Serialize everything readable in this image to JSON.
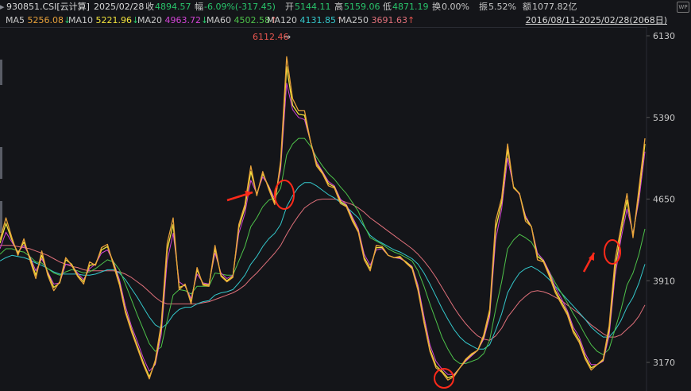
{
  "header": {
    "code": "930851.CSI[云计算]",
    "date": "2025/02/28",
    "close_label": "收",
    "close_value": "4894.57",
    "change_label": "幅",
    "change_value": "-6.09%(-317.45)",
    "open_label": "开",
    "open_value": "5144.11",
    "high_label": "高",
    "high_value": "5159.06",
    "low_label": "低",
    "low_value": "4871.19",
    "turnover_label": "换",
    "turnover_value": "0.00%",
    "amplitude_label": "振",
    "amplitude_value": "5.52%",
    "amount_label": "额",
    "amount_value": "1077.82亿",
    "range_label": "2016/08/11-2025/02/28(2068日)"
  },
  "ma_legend": [
    {
      "label": "MA5",
      "value": "5256.08",
      "arrow": "↓",
      "color": "#e8a13a"
    },
    {
      "label": "MA10",
      "value": "5221.96",
      "arrow": "↓",
      "color": "#f2e33c"
    },
    {
      "label": "MA20",
      "value": "4963.72",
      "arrow": "↓",
      "color": "#d244d6"
    },
    {
      "label": "MA60",
      "value": "4502.58",
      "arrow": "↑",
      "color": "#4ec24a"
    },
    {
      "label": "MA120",
      "value": "4131.85",
      "arrow": "↑",
      "color": "#34c8cc"
    },
    {
      "label": "MA250",
      "value": "3691.63",
      "arrow": "↑",
      "color": "#e0707a"
    }
  ],
  "corner_icon": "wp-icon",
  "chart_data": {
    "type": "line",
    "title": "",
    "yticks": [
      6130,
      5390,
      4650,
      3910,
      3170
    ],
    "ylim": [
      3000,
      6260
    ],
    "peak_label": "6112.46",
    "peak_arrow": "→",
    "grid": false,
    "series": [
      {
        "name": "MA5",
        "color": "#e8a13a",
        "values": [
          4280,
          4480,
          4300,
          4140,
          4290,
          4100,
          3930,
          4180,
          3960,
          3820,
          3900,
          4120,
          4050,
          3950,
          3880,
          4080,
          4050,
          4210,
          4240,
          4050,
          3870,
          3620,
          3450,
          3300,
          3150,
          3020,
          3190,
          3520,
          4250,
          4480,
          3830,
          3880,
          3700,
          4030,
          3870,
          3860,
          4230,
          3950,
          3900,
          3940,
          4420,
          4600,
          4950,
          4680,
          4900,
          4740,
          4600,
          5000,
          5940,
          5560,
          5450,
          5450,
          5170,
          4950,
          4880,
          4770,
          4750,
          4610,
          4580,
          4450,
          4350,
          4100,
          4000,
          4230,
          4220,
          4140,
          4120,
          4130,
          4070,
          4020,
          3820,
          3530,
          3270,
          3120,
          3080,
          3010,
          3040,
          3120,
          3200,
          3250,
          3280,
          3420,
          3650,
          4450,
          4660,
          5150,
          4750,
          4700,
          4450,
          4400,
          4100,
          4080,
          3950,
          3800,
          3700,
          3600,
          3440,
          3350,
          3200,
          3100,
          3150,
          3200,
          3500,
          4100,
          4400,
          4700,
          4300,
          4750,
          5200
        ]
      },
      {
        "name": "MA10",
        "color": "#f2e33c",
        "values": [
          4250,
          4430,
          4280,
          4160,
          4260,
          4120,
          3960,
          4140,
          3980,
          3850,
          3890,
          4100,
          4060,
          3960,
          3900,
          4050,
          4060,
          4190,
          4220,
          4070,
          3890,
          3640,
          3470,
          3320,
          3170,
          3040,
          3170,
          3480,
          4190,
          4420,
          3850,
          3870,
          3720,
          4010,
          3880,
          3870,
          4200,
          3960,
          3910,
          3950,
          4390,
          4570,
          4900,
          4690,
          4880,
          4760,
          4620,
          4970,
          5850,
          5500,
          5420,
          5410,
          5170,
          4970,
          4890,
          4790,
          4760,
          4630,
          4590,
          4470,
          4360,
          4120,
          4020,
          4210,
          4210,
          4140,
          4120,
          4120,
          4080,
          4030,
          3840,
          3550,
          3290,
          3140,
          3090,
          3030,
          3050,
          3120,
          3190,
          3240,
          3280,
          3400,
          3620,
          4380,
          4620,
          5100,
          4760,
          4700,
          4480,
          4400,
          4130,
          4090,
          3970,
          3820,
          3720,
          3620,
          3460,
          3370,
          3220,
          3120,
          3150,
          3190,
          3460,
          4020,
          4350,
          4640,
          4320,
          4700,
          5150
        ]
      },
      {
        "name": "MA20",
        "color": "#d244d6",
        "values": [
          4200,
          4350,
          4260,
          4170,
          4230,
          4130,
          4000,
          4110,
          3990,
          3880,
          3890,
          4060,
          4050,
          3980,
          3920,
          4020,
          4060,
          4160,
          4190,
          4080,
          3920,
          3680,
          3500,
          3360,
          3210,
          3090,
          3150,
          3420,
          4090,
          4340,
          3900,
          3860,
          3750,
          3970,
          3890,
          3880,
          4160,
          3980,
          3930,
          3960,
          4340,
          4520,
          4820,
          4700,
          4850,
          4770,
          4650,
          4920,
          5700,
          5460,
          5390,
          5370,
          5170,
          4990,
          4900,
          4810,
          4770,
          4650,
          4600,
          4490,
          4380,
          4150,
          4050,
          4190,
          4200,
          4140,
          4120,
          4110,
          4080,
          4040,
          3870,
          3590,
          3330,
          3180,
          3110,
          3060,
          3060,
          3120,
          3180,
          3230,
          3280,
          3380,
          3580,
          4280,
          4560,
          5020,
          4760,
          4690,
          4500,
          4400,
          4160,
          4100,
          3990,
          3850,
          3750,
          3640,
          3490,
          3400,
          3250,
          3150,
          3150,
          3180,
          3410,
          3950,
          4290,
          4560,
          4340,
          4640,
          5080
        ]
      },
      {
        "name": "MA60",
        "color": "#4ec24a",
        "values": [
          4150,
          4200,
          4200,
          4180,
          4170,
          4130,
          4080,
          4070,
          4020,
          3980,
          3960,
          3990,
          4010,
          4000,
          3980,
          3990,
          4020,
          4060,
          4100,
          4080,
          4010,
          3880,
          3740,
          3600,
          3470,
          3340,
          3270,
          3310,
          3550,
          3780,
          3830,
          3820,
          3790,
          3860,
          3860,
          3860,
          3980,
          3970,
          3960,
          3960,
          4090,
          4220,
          4400,
          4480,
          4580,
          4640,
          4660,
          4750,
          5050,
          5150,
          5200,
          5200,
          5130,
          5030,
          4950,
          4880,
          4830,
          4760,
          4700,
          4620,
          4540,
          4410,
          4300,
          4270,
          4240,
          4200,
          4170,
          4150,
          4120,
          4090,
          4000,
          3860,
          3700,
          3550,
          3400,
          3290,
          3200,
          3160,
          3160,
          3180,
          3200,
          3250,
          3370,
          3650,
          3900,
          4200,
          4280,
          4330,
          4300,
          4260,
          4160,
          4080,
          3990,
          3890,
          3800,
          3710,
          3610,
          3520,
          3420,
          3330,
          3270,
          3240,
          3290,
          3470,
          3650,
          3870,
          3980,
          4150,
          4380
        ]
      },
      {
        "name": "MA120",
        "color": "#34c8cc",
        "values": [
          4090,
          4120,
          4140,
          4130,
          4120,
          4100,
          4070,
          4050,
          4020,
          3990,
          3970,
          3970,
          3970,
          3970,
          3960,
          3960,
          3970,
          3990,
          4010,
          4010,
          3980,
          3920,
          3840,
          3760,
          3670,
          3580,
          3510,
          3480,
          3520,
          3600,
          3650,
          3670,
          3670,
          3700,
          3720,
          3730,
          3780,
          3800,
          3810,
          3830,
          3890,
          3960,
          4060,
          4130,
          4220,
          4290,
          4340,
          4420,
          4580,
          4680,
          4760,
          4800,
          4800,
          4770,
          4730,
          4690,
          4660,
          4620,
          4580,
          4530,
          4480,
          4400,
          4320,
          4280,
          4250,
          4220,
          4190,
          4170,
          4140,
          4110,
          4060,
          3980,
          3880,
          3770,
          3660,
          3560,
          3470,
          3400,
          3350,
          3320,
          3290,
          3290,
          3330,
          3460,
          3610,
          3800,
          3900,
          3980,
          4020,
          4040,
          4010,
          3970,
          3920,
          3860,
          3800,
          3740,
          3680,
          3620,
          3560,
          3490,
          3440,
          3400,
          3400,
          3460,
          3550,
          3670,
          3760,
          3890,
          4060
        ]
      },
      {
        "name": "MA250",
        "color": "#e0707a",
        "values": [
          4230,
          4230,
          4230,
          4220,
          4210,
          4200,
          4180,
          4160,
          4140,
          4110,
          4080,
          4060,
          4040,
          4030,
          4010,
          4000,
          4000,
          4000,
          4000,
          4000,
          3990,
          3970,
          3940,
          3900,
          3860,
          3810,
          3760,
          3720,
          3700,
          3700,
          3700,
          3700,
          3700,
          3700,
          3710,
          3720,
          3740,
          3760,
          3780,
          3800,
          3830,
          3870,
          3930,
          3980,
          4040,
          4100,
          4160,
          4230,
          4330,
          4420,
          4500,
          4570,
          4610,
          4640,
          4650,
          4650,
          4650,
          4640,
          4620,
          4600,
          4570,
          4530,
          4480,
          4440,
          4400,
          4360,
          4320,
          4280,
          4240,
          4200,
          4150,
          4090,
          4020,
          3940,
          3850,
          3760,
          3670,
          3590,
          3520,
          3460,
          3410,
          3380,
          3370,
          3410,
          3480,
          3580,
          3650,
          3720,
          3770,
          3810,
          3820,
          3810,
          3790,
          3760,
          3730,
          3690,
          3650,
          3610,
          3560,
          3510,
          3470,
          3430,
          3400,
          3400,
          3420,
          3470,
          3520,
          3590,
          3690
        ]
      }
    ]
  },
  "annotations": [
    {
      "kind": "circle",
      "name": "highlight-circle-2019",
      "cx": 358,
      "cy": 245,
      "rx": 12,
      "ry": 18
    },
    {
      "kind": "circle",
      "name": "highlight-circle-2022",
      "cx": 559,
      "cy": 476,
      "rx": 12,
      "ry": 12
    },
    {
      "kind": "circle",
      "name": "highlight-circle-2024",
      "cx": 771,
      "cy": 317,
      "rx": 10,
      "ry": 15
    },
    {
      "kind": "arrow",
      "name": "red-arrow-left",
      "x1": 286,
      "y1": 250,
      "x2": 318,
      "y2": 242
    },
    {
      "kind": "arrow",
      "name": "red-arrow-right",
      "x1": 735,
      "y1": 342,
      "x2": 748,
      "y2": 318
    }
  ]
}
